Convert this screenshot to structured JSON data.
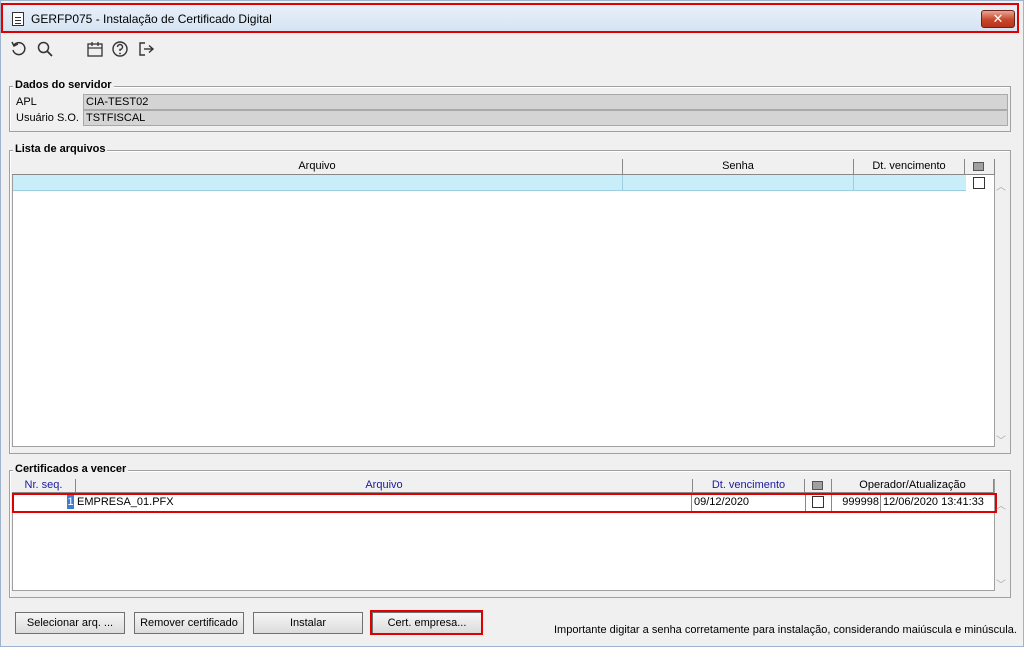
{
  "window": {
    "title": "GERFP075 - Instalação de Certificado Digital",
    "close_glyph": "✕"
  },
  "toolbar": {
    "icons": [
      "refresh-icon",
      "search-icon",
      "calendar-icon",
      "help-icon",
      "exit-icon"
    ]
  },
  "server_data": {
    "title": "Dados do servidor",
    "apl_label": "APL",
    "apl_value": "CIA-TEST02",
    "user_label": "Usuário S.O.",
    "user_value": "TSTFISCAL"
  },
  "file_list": {
    "title": "Lista de arquivos",
    "columns": [
      "Arquivo",
      "Senha",
      "Dt. vencimento"
    ]
  },
  "expiring": {
    "title": "Certificados a vencer",
    "columns": [
      "Nr. seq.",
      "Arquivo",
      "Dt. vencimento",
      "Operador/Atualização"
    ],
    "rows": [
      {
        "seq": "1",
        "arquivo": "EMPRESA_01.PFX",
        "vencimento": "09/12/2020",
        "checked": false,
        "operador": "999998",
        "atualizacao": "12/06/2020 13:41:33"
      }
    ]
  },
  "buttons": {
    "select_file": "Selecionar arq. ...",
    "remove_cert": "Remover certificado",
    "install": "Instalar",
    "cert_company": "Cert. empresa..."
  },
  "info_message": "Importante digitar a senha corretamente para instalação, considerando maiúscula e minúscula.",
  "colors": {
    "highlight": "#e00000",
    "selected_row": "#c9eefa",
    "readonly_field": "#d4d4d4"
  }
}
